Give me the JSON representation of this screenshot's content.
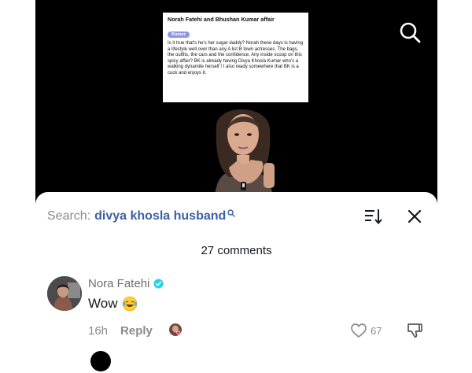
{
  "video": {
    "post": {
      "title": "Norah Fatehi and Bhushan Kumar affair",
      "tag": "Rumor",
      "body": "Is it true that's he's her sugar daddy? Norah these days is having a lifestyle well over than any A list B town actresses. The bags, the outfits, the cars and the confidence. Any inside scoop on this spicy affair? BK is already having Divya Khosla Kumar who's a walking dynamite herself ! I also ready somewhere that BK is a cuck and enjoys it."
    },
    "search_icon": "search-icon"
  },
  "comments_sheet": {
    "search_prefix": "Search:",
    "search_term": "divya khosla husband",
    "count_label": "27 comments",
    "sort_icon": "sort-icon",
    "close_icon": "close-icon",
    "comments": [
      {
        "username": "Nora Fatehi",
        "verified": true,
        "text": "Wow",
        "emoji": "laughing-tears-emoji",
        "time": "16h",
        "reply_label": "Reply",
        "likes": "67"
      }
    ]
  },
  "colors": {
    "search_term": "#3b5fa8",
    "verified": "#20d5ec",
    "tag": "#8f96e6",
    "liked_heart": "#fe2c55"
  }
}
